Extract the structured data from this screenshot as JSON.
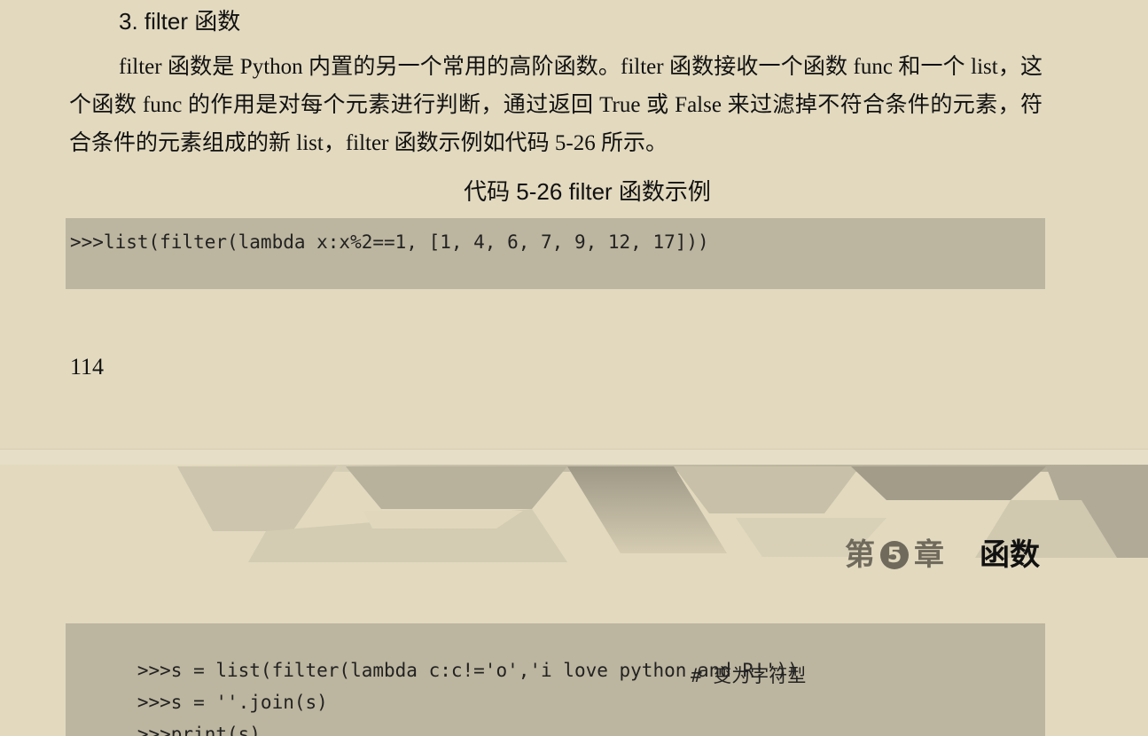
{
  "top_page": {
    "section_heading": "3. filter 函数",
    "paragraph": "filter 函数是 Python 内置的另一个常用的高阶函数。filter 函数接收一个函数 func 和一个 list，这个函数 func 的作用是对每个元素进行判断，通过返回 True 或 False 来过滤掉不符合条件的元素，符合条件的元素组成的新 list，filter 函数示例如代码 5-26 所示。",
    "code_caption": "代码 5-26    filter 函数示例",
    "code_lines": [
      ">>>list(filter(lambda x:x%2==1, [1, 4, 6, 7, 9, 12, 17]))"
    ],
    "page_number": "114"
  },
  "bottom_page": {
    "chapter_header": {
      "prefix": "第",
      "number": "5",
      "suffix": "章",
      "name": "函数"
    },
    "code_lines": [
      {
        "code": ">>>s = list(filter(lambda c:c!='o','i love python and R!'))",
        "comment": ""
      },
      {
        "code": ">>>s = ''.join(s)",
        "comment": "# 变为字符型"
      },
      {
        "code": ">>>print(s)",
        "comment": ""
      }
    ]
  },
  "colors": {
    "page_background": "#e2d9bf",
    "code_background": "#bcb59f",
    "chapter_accent": "#6f6a5c"
  }
}
